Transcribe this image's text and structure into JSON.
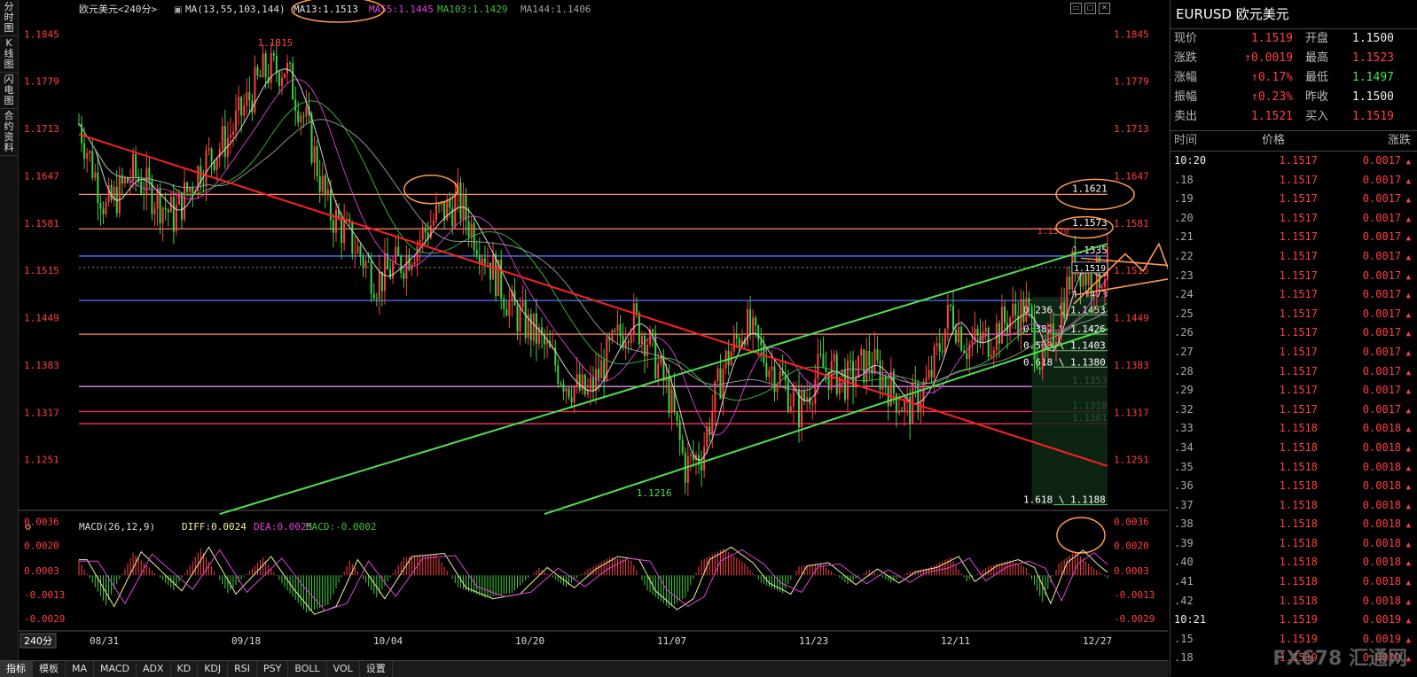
{
  "left_toolbar": [
    "分时图",
    "K线图",
    "闪电图",
    "合约资料"
  ],
  "header": {
    "symbol_period": "欧元美元<240分>",
    "ma_params": "MA(13,55,103,144)",
    "ma13": "MA13:1.1513",
    "ma55": "MA55:1.1445",
    "ma103": "MA103:1.1429",
    "ma144": "MA144:1.1406"
  },
  "price_axis": {
    "labels": [
      "1.1845",
      "1.1779",
      "1.1713",
      "1.1647",
      "1.1581",
      "1.1515",
      "1.1449",
      "1.1383",
      "1.1317",
      "1.1251"
    ]
  },
  "chart_data": {
    "type": "candlestick",
    "symbol": "EURUSD",
    "period": "240分",
    "x_labels": [
      "08/31",
      "09/18",
      "10/04",
      "10/20",
      "11/07",
      "11/23",
      "12/11",
      "12/27"
    ],
    "ylim": [
      1.1185,
      1.1875
    ],
    "close_path": [
      [
        0,
        1.172
      ],
      [
        10,
        1.16
      ],
      [
        20,
        1.165
      ],
      [
        35,
        1.159
      ],
      [
        45,
        1.166
      ],
      [
        55,
        1.17
      ],
      [
        68,
        1.179
      ],
      [
        76,
        1.18
      ],
      [
        84,
        1.172
      ],
      [
        92,
        1.16
      ],
      [
        100,
        1.156
      ],
      [
        110,
        1.15
      ],
      [
        120,
        1.153
      ],
      [
        132,
        1.159
      ],
      [
        140,
        1.161
      ],
      [
        150,
        1.154
      ],
      [
        160,
        1.146
      ],
      [
        170,
        1.142
      ],
      [
        180,
        1.136
      ],
      [
        188,
        1.134
      ],
      [
        196,
        1.14
      ],
      [
        204,
        1.145
      ],
      [
        210,
        1.142
      ],
      [
        218,
        1.134
      ],
      [
        224,
        1.124
      ],
      [
        230,
        1.126
      ],
      [
        238,
        1.138
      ],
      [
        246,
        1.144
      ],
      [
        252,
        1.14
      ],
      [
        260,
        1.136
      ],
      [
        266,
        1.132
      ],
      [
        274,
        1.138
      ],
      [
        284,
        1.136
      ],
      [
        292,
        1.139
      ],
      [
        300,
        1.135
      ],
      [
        306,
        1.132
      ],
      [
        314,
        1.136
      ],
      [
        322,
        1.146
      ],
      [
        328,
        1.141
      ],
      [
        336,
        1.142
      ],
      [
        344,
        1.145
      ],
      [
        350,
        1.146
      ],
      [
        356,
        1.138
      ],
      [
        362,
        1.145
      ],
      [
        368,
        1.153
      ],
      [
        374,
        1.15
      ],
      [
        380,
        1.1519
      ]
    ],
    "moving_averages": [
      {
        "name": "MA13",
        "value": 1.1513,
        "color": "#e8e8e8"
      },
      {
        "name": "MA55",
        "value": 1.1445,
        "color": "#e040e0"
      },
      {
        "name": "MA103",
        "value": 1.1429,
        "color": "#40c040"
      },
      {
        "name": "MA144",
        "value": 1.1406,
        "color": "#a0a0a0"
      }
    ],
    "annotations": {
      "high": "1.1815",
      "low": "1.1216",
      "horizontal_levels": [
        {
          "value": 1.1621,
          "label": "1.1621",
          "color": "#ff8a66"
        },
        {
          "value": 1.1573,
          "label": "1.1573",
          "color": "#ff8a66"
        },
        {
          "value": 1.1535,
          "label": "1.1535",
          "color": "#4a7aff"
        },
        {
          "value": 1.1473,
          "label": "1.1473",
          "color": "#4a7aff"
        },
        {
          "value": 1.1426,
          "label": "1.1426",
          "color": "#ff8a66"
        },
        {
          "value": 1.1353,
          "label": "1.1353",
          "color": "#ff9aff"
        },
        {
          "value": 1.1318,
          "label": "1.1318",
          "color": "#ff3060"
        },
        {
          "value": 1.1301,
          "label": "1.1301",
          "color": "#ff3060"
        }
      ],
      "fib_labels": [
        "0.236 \\ 1.1453",
        "0.382 \\ 1.1426",
        "0.500 \\ 1.1403",
        "0.618 \\ 1.1380",
        "1.618 \\ 1.1188"
      ],
      "side_labels": [
        "1.1570",
        "1.1519"
      ]
    }
  },
  "macd": {
    "title": "MACD(26,12,9)",
    "diff": "DIFF:0.0024",
    "dea": "DEA:0.0025",
    "macd": "MACD:-0.0002",
    "axis_labels": [
      "0.0036",
      "0.0020",
      "0.0003",
      "-0.0013",
      "-0.0029"
    ],
    "chart_data": {
      "type": "bar+line",
      "ylim": [
        -0.0035,
        0.004
      ],
      "hist_path": [
        [
          0,
          0.001
        ],
        [
          10,
          -0.002
        ],
        [
          20,
          0.0015
        ],
        [
          35,
          -0.001
        ],
        [
          45,
          0.0018
        ],
        [
          55,
          -0.0012
        ],
        [
          68,
          0.0012
        ],
        [
          76,
          -0.0008
        ],
        [
          84,
          -0.0025
        ],
        [
          92,
          -0.002
        ],
        [
          100,
          0.001
        ],
        [
          110,
          -0.0015
        ],
        [
          120,
          0.0012
        ],
        [
          132,
          0.0014
        ],
        [
          140,
          -0.0008
        ],
        [
          150,
          -0.0015
        ],
        [
          160,
          -0.0012
        ],
        [
          170,
          0.0005
        ],
        [
          180,
          -0.0008
        ],
        [
          188,
          0.0004
        ],
        [
          196,
          0.0012
        ],
        [
          204,
          0.001
        ],
        [
          210,
          -0.001
        ],
        [
          218,
          -0.0022
        ],
        [
          224,
          -0.0015
        ],
        [
          230,
          0.001
        ],
        [
          238,
          0.0018
        ],
        [
          246,
          0.0008
        ],
        [
          252,
          -0.0005
        ],
        [
          260,
          -0.0012
        ],
        [
          266,
          0.0006
        ],
        [
          274,
          0.0008
        ],
        [
          284,
          -0.0006
        ],
        [
          292,
          0.0004
        ],
        [
          300,
          -0.0005
        ],
        [
          306,
          0.0002
        ],
        [
          314,
          0.0005
        ],
        [
          322,
          0.0012
        ],
        [
          328,
          -0.0004
        ],
        [
          336,
          0.0006
        ],
        [
          344,
          0.001
        ],
        [
          350,
          0.0005
        ],
        [
          356,
          -0.0018
        ],
        [
          362,
          0.0008
        ],
        [
          368,
          0.0016
        ],
        [
          374,
          0.0006
        ],
        [
          380,
          -0.0002
        ]
      ]
    }
  },
  "period_button": "240分",
  "bottom_tabs": [
    "指标",
    "模板",
    "MA",
    "MACD",
    "ADX",
    "KD",
    "KDJ",
    "RSI",
    "PSY",
    "BOLL",
    "VOL",
    "设置"
  ],
  "right_panel": {
    "title": "EURUSD 欧元美元",
    "quotes": [
      {
        "l1": "现价",
        "v1": "1.1519",
        "c1": "red",
        "l2": "开盘",
        "v2": "1.1500",
        "c2": "white"
      },
      {
        "l1": "涨跌",
        "v1": "↑0.0019",
        "c1": "red",
        "l2": "最高",
        "v2": "1.1523",
        "c2": "red"
      },
      {
        "l1": "涨幅",
        "v1": "↑0.17%",
        "c1": "red",
        "l2": "最低",
        "v2": "1.1497",
        "c2": "green"
      },
      {
        "l1": "振幅",
        "v1": "↑0.23%",
        "c1": "red",
        "l2": "昨收",
        "v2": "1.1500",
        "c2": "white"
      },
      {
        "l1": "卖出",
        "v1": "1.1521",
        "c1": "red",
        "l2": "买入",
        "v2": "1.1519",
        "c2": "red"
      }
    ],
    "table_headers": [
      "时间",
      "价格",
      "涨跌"
    ],
    "ticks": [
      {
        "t": "10:20",
        "p": "1.1517",
        "c": "0.0017"
      },
      {
        "t": ".18",
        "p": "1.1517",
        "c": "0.0017"
      },
      {
        "t": ".19",
        "p": "1.1517",
        "c": "0.0017"
      },
      {
        "t": ".20",
        "p": "1.1517",
        "c": "0.0017"
      },
      {
        "t": ".21",
        "p": "1.1517",
        "c": "0.0017"
      },
      {
        "t": ".22",
        "p": "1.1517",
        "c": "0.0017"
      },
      {
        "t": ".23",
        "p": "1.1517",
        "c": "0.0017"
      },
      {
        "t": ".24",
        "p": "1.1517",
        "c": "0.0017"
      },
      {
        "t": ".25",
        "p": "1.1517",
        "c": "0.0017"
      },
      {
        "t": ".26",
        "p": "1.1517",
        "c": "0.0017"
      },
      {
        "t": ".27",
        "p": "1.1517",
        "c": "0.0017"
      },
      {
        "t": ".28",
        "p": "1.1517",
        "c": "0.0017"
      },
      {
        "t": ".29",
        "p": "1.1517",
        "c": "0.0017"
      },
      {
        "t": ".32",
        "p": "1.1517",
        "c": "0.0017"
      },
      {
        "t": ".33",
        "p": "1.1518",
        "c": "0.0018"
      },
      {
        "t": ".34",
        "p": "1.1518",
        "c": "0.0018"
      },
      {
        "t": ".35",
        "p": "1.1518",
        "c": "0.0018"
      },
      {
        "t": ".36",
        "p": "1.1518",
        "c": "0.0018"
      },
      {
        "t": ".37",
        "p": "1.1518",
        "c": "0.0018"
      },
      {
        "t": ".38",
        "p": "1.1518",
        "c": "0.0018"
      },
      {
        "t": ".39",
        "p": "1.1518",
        "c": "0.0018"
      },
      {
        "t": ".40",
        "p": "1.1518",
        "c": "0.0018"
      },
      {
        "t": ".41",
        "p": "1.1518",
        "c": "0.0018"
      },
      {
        "t": ".42",
        "p": "1.1518",
        "c": "0.0018"
      },
      {
        "t": "10:21",
        "p": "1.1519",
        "c": "0.0019"
      },
      {
        "t": ".15",
        "p": "1.1519",
        "c": "0.0019"
      },
      {
        "t": ".18",
        "p": "1.1519",
        "c": "0.0019"
      }
    ],
    "watermark": "FX678 汇通网"
  },
  "colors": {
    "up": "#ff4040",
    "down": "#40d040",
    "trend_red": "#ff2020",
    "trend_green": "#50e050",
    "circle": "#ff9a50"
  }
}
